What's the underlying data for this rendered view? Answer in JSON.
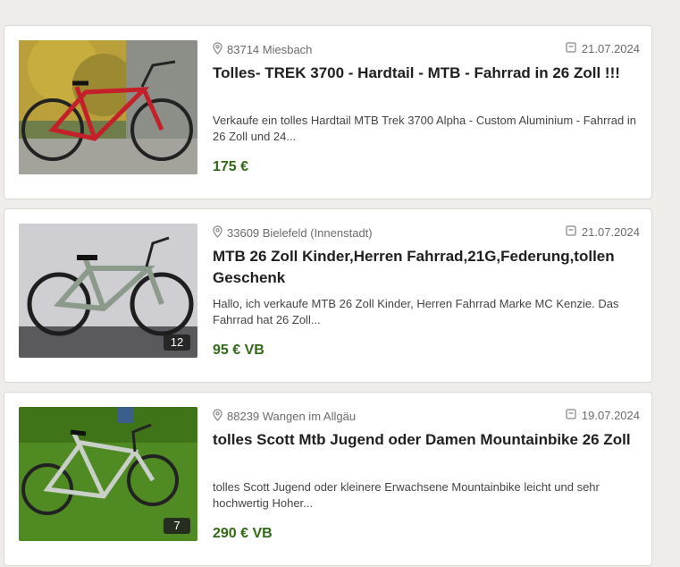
{
  "listings": [
    {
      "location": "83714 Miesbach",
      "date": "21.07.2024",
      "title": "Tolles- TREK 3700 - Hardtail - MTB - Fahrrad in 26 Zoll !!!",
      "description": "Verkaufe ein tolles Hardtail MTB Trek 3700 Alpha - Custom Aluminium - Fahrrad in 26 Zoll und 24...",
      "price": "175 €",
      "image_count": ""
    },
    {
      "location": "33609 Bielefeld (Innenstadt)",
      "date": "21.07.2024",
      "title": "MTB 26 Zoll Kinder,Herren Fahrrad,21G,Federung,tollen Geschenk",
      "description": "Hallo, ich verkaufe MTB 26 Zoll Kinder, Herren Fahrrad Marke MC Kenzie. Das Fahrrad hat 26 Zoll...",
      "price": "95 € VB",
      "image_count": "12"
    },
    {
      "location": "88239 Wangen im Allgäu",
      "date": "19.07.2024",
      "title": "tolles Scott Mtb Jugend oder Damen Mountainbike 26 Zoll",
      "description": "tolles Scott Jugend oder kleinere Erwachsene Mountainbike leicht und sehr hochwertig Hoher...",
      "price": "290 € VB",
      "image_count": "7"
    }
  ],
  "colors": {
    "price": "#326916",
    "background": "#efedea"
  },
  "icons": {
    "location": "location-pin-icon",
    "date": "calendar-icon"
  }
}
